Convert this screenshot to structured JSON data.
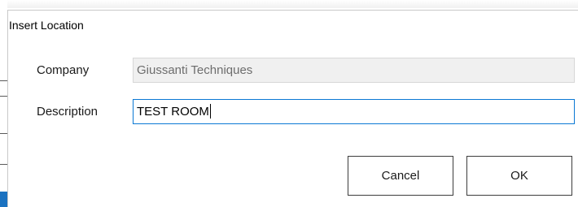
{
  "dialog": {
    "title": "Insert Location"
  },
  "form": {
    "company_label": "Company",
    "company_value": "Giussanti Techniques",
    "description_label": "Description",
    "description_value": "TEST ROOM"
  },
  "buttons": {
    "cancel_label": "Cancel",
    "ok_label": "OK"
  },
  "colors": {
    "focus_border": "#0a78d4",
    "readonly_bg": "#f0f0f0"
  }
}
